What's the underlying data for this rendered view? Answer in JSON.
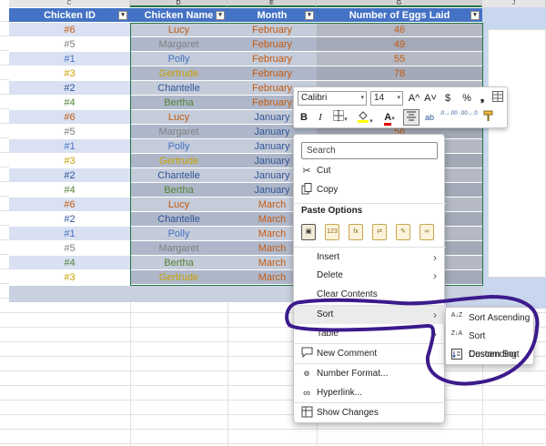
{
  "column_letters": [
    "C",
    "D",
    "E",
    "F",
    "G",
    "J"
  ],
  "table": {
    "headers": [
      "Chicken ID",
      "Chicken Name",
      "Month",
      "Number of Eggs Laid"
    ],
    "filter_glyph": "▾",
    "rows": [
      {
        "id": "#6",
        "name": "Lucy",
        "month": "February",
        "eggs": "46"
      },
      {
        "id": "#5",
        "name": "Margaret",
        "month": "February",
        "eggs": "49"
      },
      {
        "id": "#1",
        "name": "Polly",
        "month": "February",
        "eggs": "55"
      },
      {
        "id": "#3",
        "name": "Gertrude",
        "month": "February",
        "eggs": "78"
      },
      {
        "id": "#2",
        "name": "Chantelle",
        "month": "February",
        "eggs": ""
      },
      {
        "id": "#4",
        "name": "Bertha",
        "month": "February",
        "eggs": ""
      },
      {
        "id": "#6",
        "name": "Lucy",
        "month": "January",
        "eggs": ""
      },
      {
        "id": "#5",
        "name": "Margaret",
        "month": "January",
        "eggs": "56"
      },
      {
        "id": "#1",
        "name": "Polly",
        "month": "January",
        "eggs": ""
      },
      {
        "id": "#3",
        "name": "Gertrude",
        "month": "January",
        "eggs": ""
      },
      {
        "id": "#2",
        "name": "Chantelle",
        "month": "January",
        "eggs": ""
      },
      {
        "id": "#4",
        "name": "Bertha",
        "month": "January",
        "eggs": ""
      },
      {
        "id": "#6",
        "name": "Lucy",
        "month": "March",
        "eggs": ""
      },
      {
        "id": "#2",
        "name": "Chantelle",
        "month": "March",
        "eggs": ""
      },
      {
        "id": "#1",
        "name": "Polly",
        "month": "March",
        "eggs": ""
      },
      {
        "id": "#5",
        "name": "Margaret",
        "month": "March",
        "eggs": ""
      },
      {
        "id": "#4",
        "name": "Bertha",
        "month": "March",
        "eggs": ""
      },
      {
        "id": "#3",
        "name": "Gertrude",
        "month": "March",
        "eggs": ""
      }
    ]
  },
  "chicken_colors": {
    "#1": "#4472c4",
    "#2": "#2f5597",
    "#3": "#c9a000",
    "#4": "#548235",
    "#5": "#7f7f7f",
    "#6": "#c55a11"
  },
  "month_colors": {
    "February": "#c55a11",
    "January": "#2f5597",
    "March": "#c55a11"
  },
  "eggs_color": "#c55a11",
  "mini_toolbar": {
    "font_name": "Calibri",
    "font_size": "14",
    "grow_font": "A^",
    "shrink_font": "A˅",
    "currency": "$",
    "percent": "%",
    "comma": "❟",
    "bold": "B",
    "italic": "I",
    "font_color_glyph": "A",
    "increase_decimal": ".0→.00",
    "decrease_decimal": ".00→.0"
  },
  "context_menu": {
    "search_placeholder": "Search",
    "cut": "Cut",
    "copy": "Copy",
    "paste_options": "Paste Options",
    "insert": "Insert",
    "delete": "Delete",
    "clear_contents": "Clear Contents",
    "sort": "Sort",
    "table": "Table",
    "new_comment": "New Comment",
    "number_format": "Number Format...",
    "hyperlink": "Hyperlink...",
    "show_changes": "Show Changes",
    "arrow": "›"
  },
  "sort_submenu": {
    "ascending": "Sort Ascending",
    "descending": "Sort Descending",
    "custom": "Custom Sort",
    "az_icon": "A↓Z",
    "za_icon": "Z↓A"
  },
  "annotation_color": "#3c1a8c"
}
